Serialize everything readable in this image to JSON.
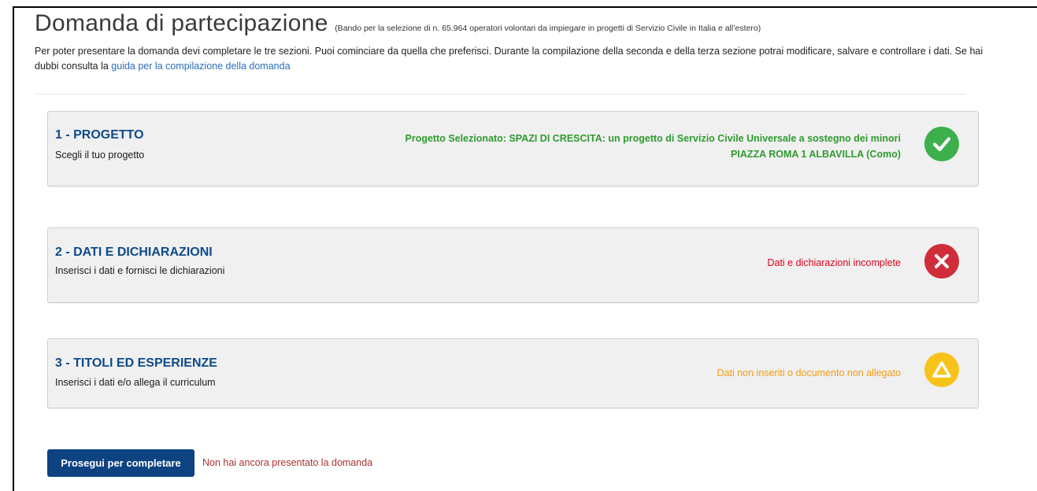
{
  "header": {
    "title": "Domanda di partecipazione",
    "subtitle": "(Bando per la selezione di n. 65.964 operatori volontari da impiegare in progetti di Servizio Civile in Italia e all’estero)",
    "intro_text": "Per poter presentare la domanda devi completare le tre sezioni. Puoi cominciare da quella che preferisci. Durante la compilazione della seconda e della terza sezione potrai modificare, salvare e controllare i dati. Se hai dubbi consulta la ",
    "guide_link": "guida per la compilazione della domanda"
  },
  "sections": [
    {
      "title": "1 - PROGETTO",
      "subtitle": "Scegli il tuo progetto",
      "status_line1": "Progetto Selezionato: SPAZI DI CRESCITA: un progetto di Servizio Civile Universale a sostegno dei minori",
      "status_line2": "PIAZZA ROMA 1 ALBAVILLA (Como)",
      "status_icon": "check-circle-icon",
      "status_color": "#3cb04a"
    },
    {
      "title": "2 - DATI E DICHIARAZIONI",
      "subtitle": "Inserisci i dati e fornisci le dichiarazioni",
      "status_line1": "Dati e dichiarazioni incomplete",
      "status_icon": "x-circle-icon",
      "status_color": "#d02d3b"
    },
    {
      "title": "3 - TITOLI ED ESPERIENZE",
      "subtitle": "Inserisci i dati e/o allega il curriculum",
      "status_line1": "Dati non inseriti o documento non allegato",
      "status_icon": "warning-triangle-icon",
      "status_color": "#f7c31b"
    }
  ],
  "footer": {
    "continue_button": "Prosegui per completare",
    "status_message": "Non hai ancora presentato la domanda"
  },
  "colors": {
    "primary": "#0d4380",
    "section_title": "#0d4b8a",
    "link": "#2a6eb7",
    "success": "#2f9b2f",
    "error": "#e3001b",
    "warning": "#f39c12"
  }
}
